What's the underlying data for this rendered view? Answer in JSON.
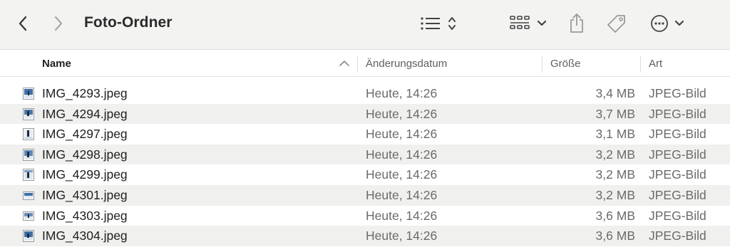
{
  "toolbar": {
    "title": "Foto-Ordner",
    "back_icon": "chevron-left-icon",
    "forward_icon": "chevron-right-icon",
    "view_icon": "list-view-icon",
    "group_icon": "group-by-icon",
    "share_icon": "share-icon",
    "tag_icon": "tag-icon",
    "more_icon": "ellipsis-circle-icon"
  },
  "columns": {
    "name": "Name",
    "date": "Änderungsdatum",
    "size": "Größe",
    "kind": "Art",
    "sort_icon": "chevron-up-icon"
  },
  "files": [
    {
      "name": "IMG_4293.jpeg",
      "date": "Heute, 14:26",
      "size": "3,4 MB",
      "kind": "JPEG-Bild"
    },
    {
      "name": "IMG_4294.jpeg",
      "date": "Heute, 14:26",
      "size": "3,7 MB",
      "kind": "JPEG-Bild"
    },
    {
      "name": "IMG_4297.jpeg",
      "date": "Heute, 14:26",
      "size": "3,1 MB",
      "kind": "JPEG-Bild"
    },
    {
      "name": "IMG_4298.jpeg",
      "date": "Heute, 14:26",
      "size": "3,2 MB",
      "kind": "JPEG-Bild"
    },
    {
      "name": "IMG_4299.jpeg",
      "date": "Heute, 14:26",
      "size": "3,2 MB",
      "kind": "JPEG-Bild"
    },
    {
      "name": "IMG_4301.jpeg",
      "date": "Heute, 14:26",
      "size": "3,2 MB",
      "kind": "JPEG-Bild"
    },
    {
      "name": "IMG_4303.jpeg",
      "date": "Heute, 14:26",
      "size": "3,6 MB",
      "kind": "JPEG-Bild"
    },
    {
      "name": "IMG_4304.jpeg",
      "date": "Heute, 14:26",
      "size": "3,6 MB",
      "kind": "JPEG-Bild"
    }
  ],
  "colors": {
    "toolbar_bg": "#f3f3f2",
    "row_alt": "#f0f0ef",
    "thumb_sky": "#3e6fa8"
  }
}
